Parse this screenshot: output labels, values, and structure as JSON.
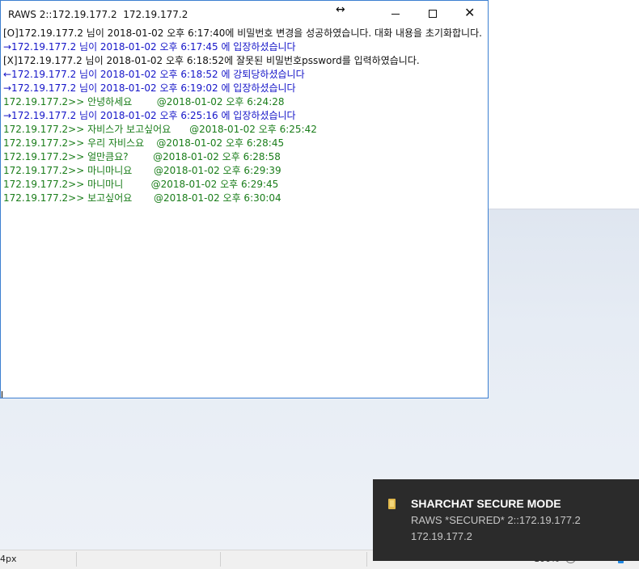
{
  "chat_window": {
    "title": "RAWS 2::172.19.177.2  172.19.177.2",
    "messages": [
      {
        "text": "[O]172.19.177.2 님이 2018-01-02 오후 6:17:40에 비밀번호 변경을 성공하였습니다. 대화 내용을 초기화합니다.",
        "color": "#111111"
      },
      {
        "text": "→172.19.177.2 님이 2018-01-02 오후 6:17:45 에 입장하셨습니다",
        "color": "#1515c8"
      },
      {
        "text": "[X]172.19.177.2 님이 2018-01-02 오후 6:18:52에 잘못된 비밀번호pssword를 입력하였습니다.",
        "color": "#111111"
      },
      {
        "text": "←172.19.177.2 님이 2018-01-02 오후 6:18:52 에 강퇴당하셨습니다",
        "color": "#1515c8"
      },
      {
        "text": "→172.19.177.2 님이 2018-01-02 오후 6:19:02 에 입장하셨습니다",
        "color": "#1515c8"
      },
      {
        "text": "172.19.177.2>> 안녕하세요        @2018-01-02 오후 6:24:28",
        "color": "#1a7d1a"
      },
      {
        "text": "→172.19.177.2 님이 2018-01-02 오후 6:25:16 에 입장하셨습니다",
        "color": "#1515c8"
      },
      {
        "text": "172.19.177.2>> 자비스가 보고싶어요      @2018-01-02 오후 6:25:42",
        "color": "#1a7d1a"
      },
      {
        "text": "172.19.177.2>> 우리 자비스요    @2018-01-02 오후 6:28:45",
        "color": "#1a7d1a"
      },
      {
        "text": "172.19.177.2>> 얼만큼요?        @2018-01-02 오후 6:28:58",
        "color": "#1a7d1a"
      },
      {
        "text": "172.19.177.2>> 마니마니요       @2018-01-02 오후 6:29:39",
        "color": "#1a7d1a"
      },
      {
        "text": "172.19.177.2>> 마니마니         @2018-01-02 오후 6:29:45",
        "color": "#1a7d1a"
      },
      {
        "text": "172.19.177.2>> 보고싶어요       @2018-01-02 오후 6:30:04",
        "color": "#1a7d1a"
      }
    ]
  },
  "notification": {
    "title": "SHARCHAT SECURE MODE",
    "line1": "RAWS *SECURED* 2::172.19.177.2",
    "line2": "172.19.177.2",
    "icon": "folder-icon"
  },
  "background_app": {
    "status_position": "4px",
    "zoom_label": "100%"
  },
  "icons": {
    "resize": "↔",
    "close": "✕"
  }
}
